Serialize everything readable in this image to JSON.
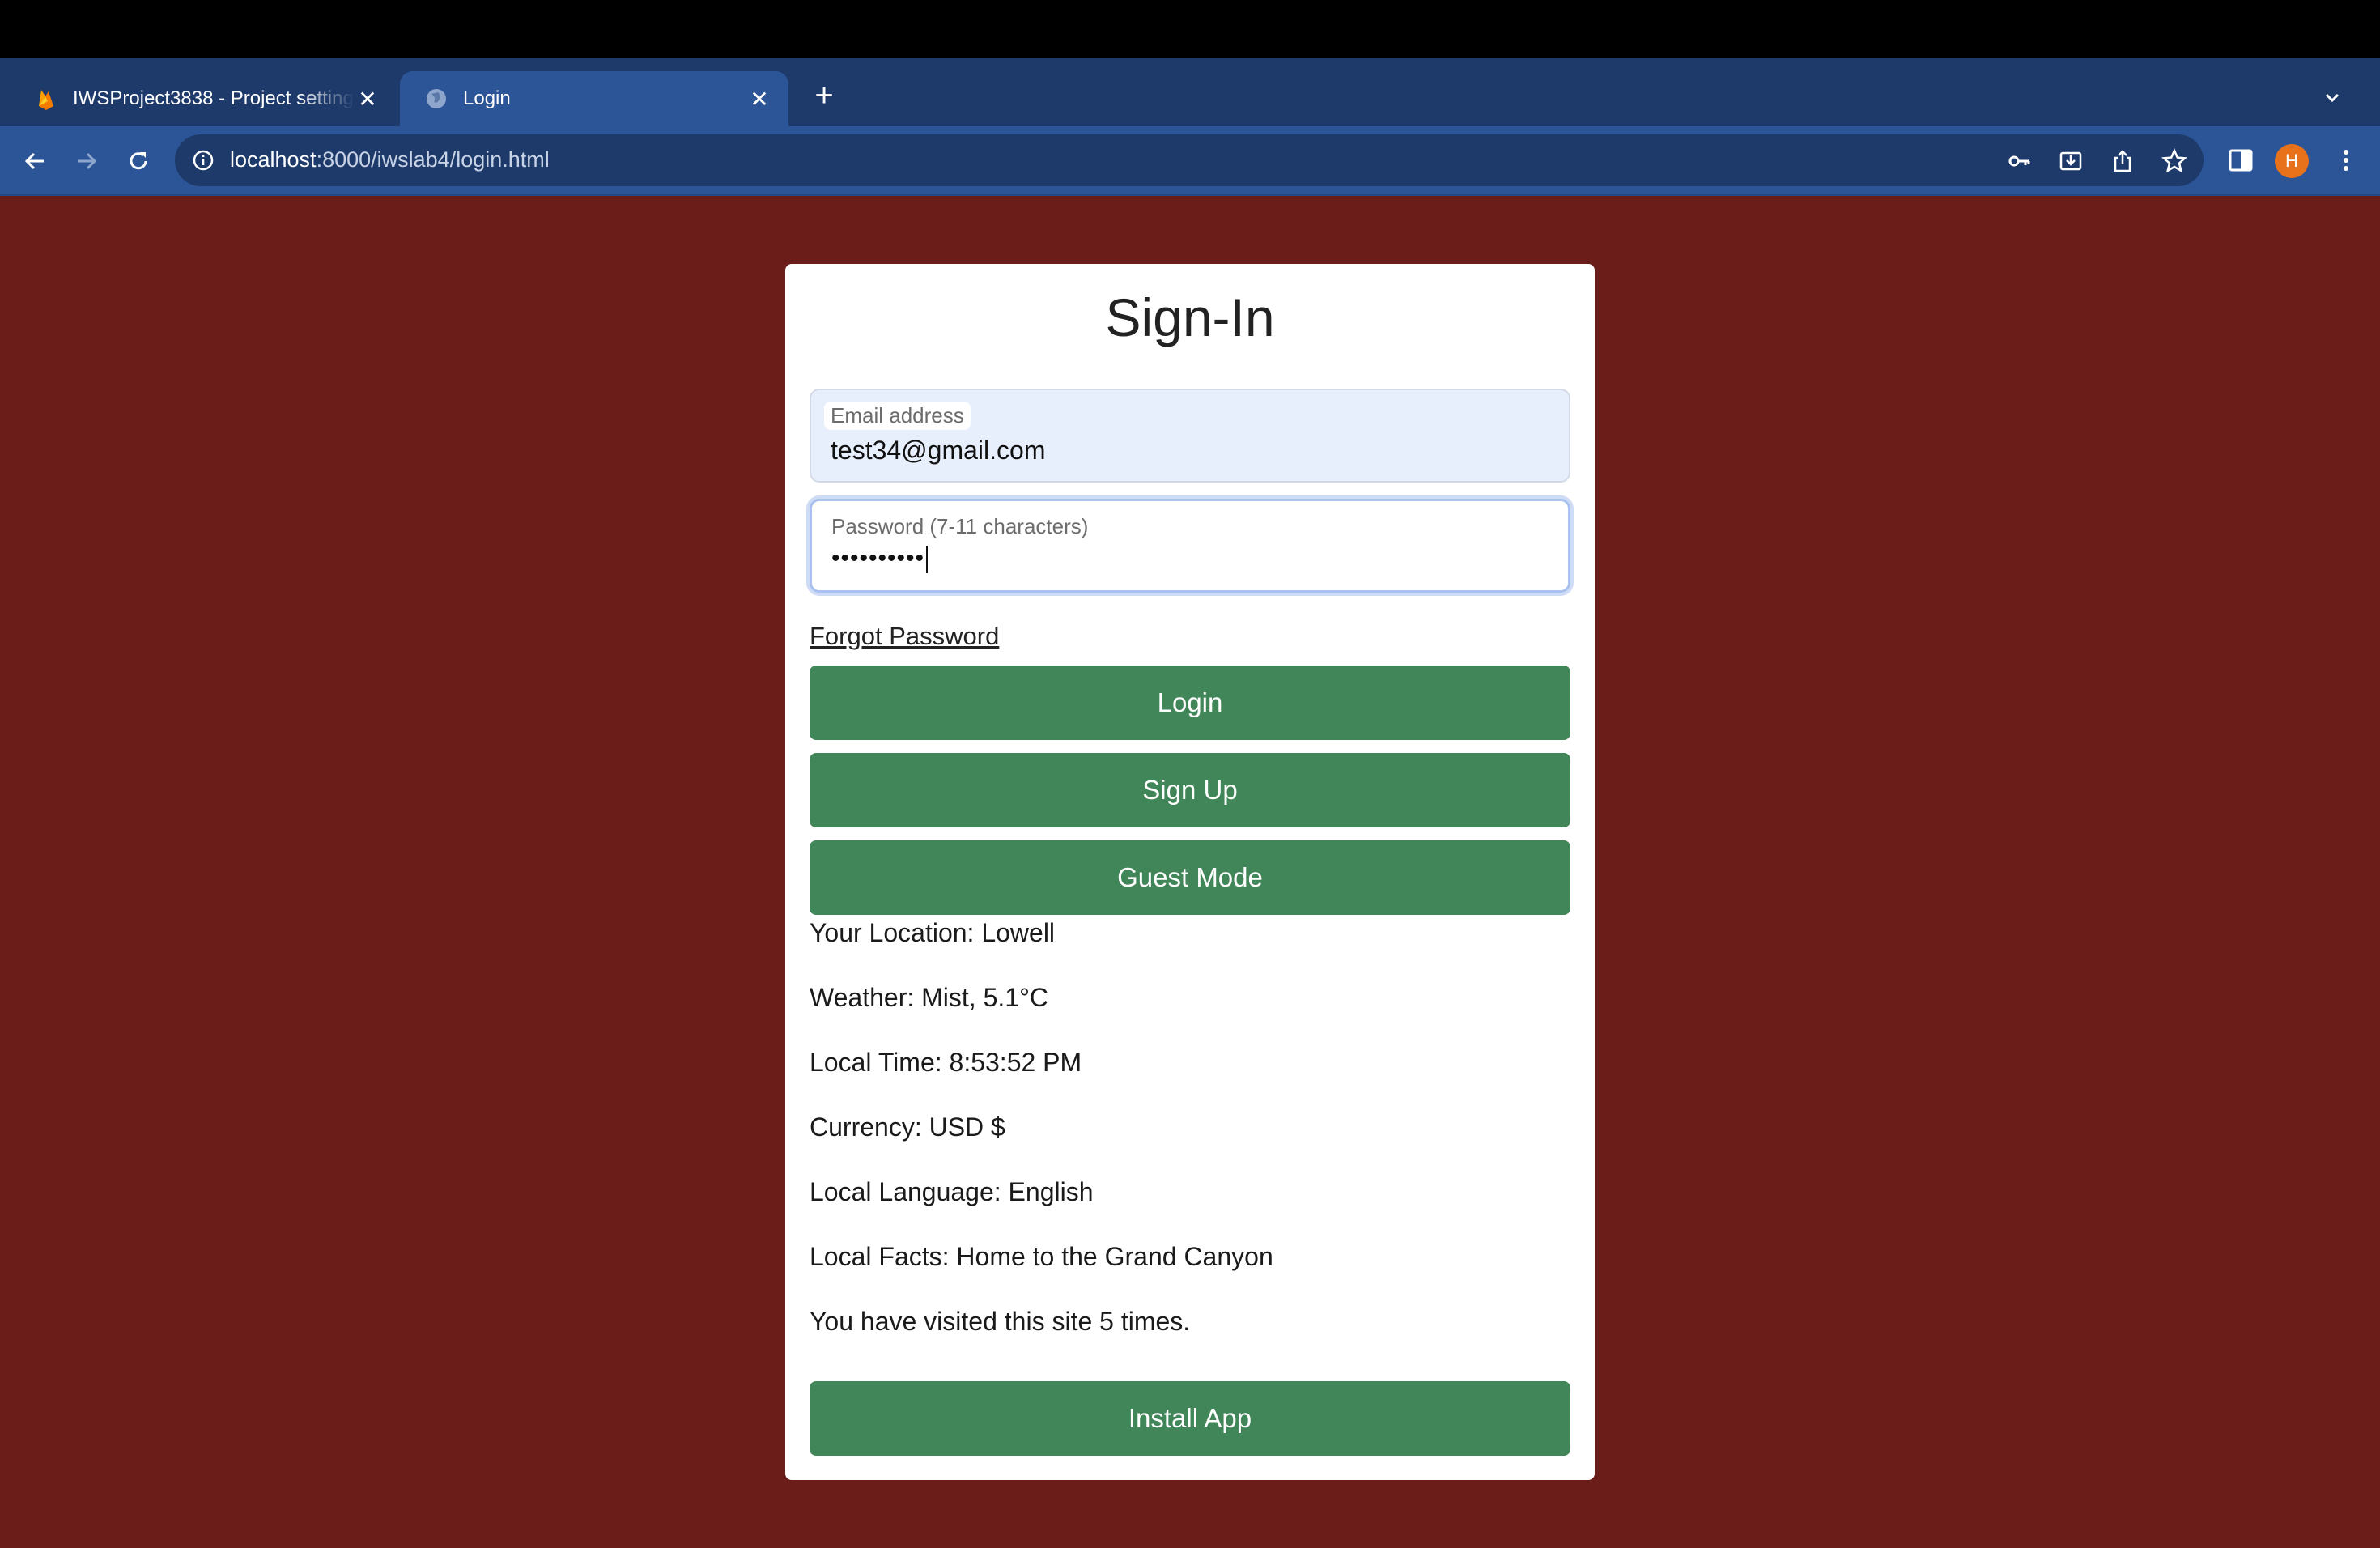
{
  "browser": {
    "tabs": [
      {
        "title": "IWSProject3838 - Project settings",
        "favicon": "firebase-icon",
        "active": false
      },
      {
        "title": "Login",
        "favicon": "globe-icon",
        "active": true
      }
    ],
    "url_host": "localhost",
    "url_path": ":8000/iwslab4/login.html",
    "profile_initial": "H",
    "colors": {
      "tabstrip": "#1e3a6b",
      "toolbar": "#2c5597",
      "avatar": "#e8711c"
    }
  },
  "page": {
    "background": "#6b1d1a",
    "heading": "Sign-In",
    "email": {
      "label": "Email address",
      "value": "test34@gmail.com"
    },
    "password": {
      "label": "Password (7-11 characters)",
      "value": "••••••••••"
    },
    "forgot_link": "Forgot Password",
    "buttons": {
      "login": "Login",
      "signup": "Sign Up",
      "guest": "Guest Mode",
      "install": "Install App"
    },
    "button_color": "#418658",
    "info": {
      "location": "Your Location: Lowell",
      "weather": "Weather: Mist, 5.1°C",
      "time": "Local Time: 8:53:52 PM",
      "currency": "Currency: USD $",
      "language": "Local Language: English",
      "facts": "Local Facts: Home to the Grand Canyon",
      "visits": "You have visited this site 5 times."
    }
  }
}
